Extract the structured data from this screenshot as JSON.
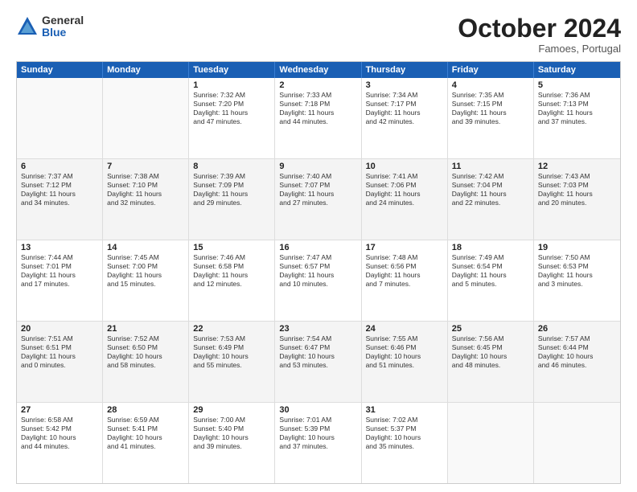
{
  "logo": {
    "general": "General",
    "blue": "Blue"
  },
  "title": "October 2024",
  "location": "Famoes, Portugal",
  "header_days": [
    "Sunday",
    "Monday",
    "Tuesday",
    "Wednesday",
    "Thursday",
    "Friday",
    "Saturday"
  ],
  "weeks": [
    {
      "alt": false,
      "days": [
        {
          "num": "",
          "lines": [],
          "empty": true
        },
        {
          "num": "",
          "lines": [],
          "empty": true
        },
        {
          "num": "1",
          "lines": [
            "Sunrise: 7:32 AM",
            "Sunset: 7:20 PM",
            "Daylight: 11 hours",
            "and 47 minutes."
          ],
          "empty": false
        },
        {
          "num": "2",
          "lines": [
            "Sunrise: 7:33 AM",
            "Sunset: 7:18 PM",
            "Daylight: 11 hours",
            "and 44 minutes."
          ],
          "empty": false
        },
        {
          "num": "3",
          "lines": [
            "Sunrise: 7:34 AM",
            "Sunset: 7:17 PM",
            "Daylight: 11 hours",
            "and 42 minutes."
          ],
          "empty": false
        },
        {
          "num": "4",
          "lines": [
            "Sunrise: 7:35 AM",
            "Sunset: 7:15 PM",
            "Daylight: 11 hours",
            "and 39 minutes."
          ],
          "empty": false
        },
        {
          "num": "5",
          "lines": [
            "Sunrise: 7:36 AM",
            "Sunset: 7:13 PM",
            "Daylight: 11 hours",
            "and 37 minutes."
          ],
          "empty": false
        }
      ]
    },
    {
      "alt": true,
      "days": [
        {
          "num": "6",
          "lines": [
            "Sunrise: 7:37 AM",
            "Sunset: 7:12 PM",
            "Daylight: 11 hours",
            "and 34 minutes."
          ],
          "empty": false
        },
        {
          "num": "7",
          "lines": [
            "Sunrise: 7:38 AM",
            "Sunset: 7:10 PM",
            "Daylight: 11 hours",
            "and 32 minutes."
          ],
          "empty": false
        },
        {
          "num": "8",
          "lines": [
            "Sunrise: 7:39 AM",
            "Sunset: 7:09 PM",
            "Daylight: 11 hours",
            "and 29 minutes."
          ],
          "empty": false
        },
        {
          "num": "9",
          "lines": [
            "Sunrise: 7:40 AM",
            "Sunset: 7:07 PM",
            "Daylight: 11 hours",
            "and 27 minutes."
          ],
          "empty": false
        },
        {
          "num": "10",
          "lines": [
            "Sunrise: 7:41 AM",
            "Sunset: 7:06 PM",
            "Daylight: 11 hours",
            "and 24 minutes."
          ],
          "empty": false
        },
        {
          "num": "11",
          "lines": [
            "Sunrise: 7:42 AM",
            "Sunset: 7:04 PM",
            "Daylight: 11 hours",
            "and 22 minutes."
          ],
          "empty": false
        },
        {
          "num": "12",
          "lines": [
            "Sunrise: 7:43 AM",
            "Sunset: 7:03 PM",
            "Daylight: 11 hours",
            "and 20 minutes."
          ],
          "empty": false
        }
      ]
    },
    {
      "alt": false,
      "days": [
        {
          "num": "13",
          "lines": [
            "Sunrise: 7:44 AM",
            "Sunset: 7:01 PM",
            "Daylight: 11 hours",
            "and 17 minutes."
          ],
          "empty": false
        },
        {
          "num": "14",
          "lines": [
            "Sunrise: 7:45 AM",
            "Sunset: 7:00 PM",
            "Daylight: 11 hours",
            "and 15 minutes."
          ],
          "empty": false
        },
        {
          "num": "15",
          "lines": [
            "Sunrise: 7:46 AM",
            "Sunset: 6:58 PM",
            "Daylight: 11 hours",
            "and 12 minutes."
          ],
          "empty": false
        },
        {
          "num": "16",
          "lines": [
            "Sunrise: 7:47 AM",
            "Sunset: 6:57 PM",
            "Daylight: 11 hours",
            "and 10 minutes."
          ],
          "empty": false
        },
        {
          "num": "17",
          "lines": [
            "Sunrise: 7:48 AM",
            "Sunset: 6:56 PM",
            "Daylight: 11 hours",
            "and 7 minutes."
          ],
          "empty": false
        },
        {
          "num": "18",
          "lines": [
            "Sunrise: 7:49 AM",
            "Sunset: 6:54 PM",
            "Daylight: 11 hours",
            "and 5 minutes."
          ],
          "empty": false
        },
        {
          "num": "19",
          "lines": [
            "Sunrise: 7:50 AM",
            "Sunset: 6:53 PM",
            "Daylight: 11 hours",
            "and 3 minutes."
          ],
          "empty": false
        }
      ]
    },
    {
      "alt": true,
      "days": [
        {
          "num": "20",
          "lines": [
            "Sunrise: 7:51 AM",
            "Sunset: 6:51 PM",
            "Daylight: 11 hours",
            "and 0 minutes."
          ],
          "empty": false
        },
        {
          "num": "21",
          "lines": [
            "Sunrise: 7:52 AM",
            "Sunset: 6:50 PM",
            "Daylight: 10 hours",
            "and 58 minutes."
          ],
          "empty": false
        },
        {
          "num": "22",
          "lines": [
            "Sunrise: 7:53 AM",
            "Sunset: 6:49 PM",
            "Daylight: 10 hours",
            "and 55 minutes."
          ],
          "empty": false
        },
        {
          "num": "23",
          "lines": [
            "Sunrise: 7:54 AM",
            "Sunset: 6:47 PM",
            "Daylight: 10 hours",
            "and 53 minutes."
          ],
          "empty": false
        },
        {
          "num": "24",
          "lines": [
            "Sunrise: 7:55 AM",
            "Sunset: 6:46 PM",
            "Daylight: 10 hours",
            "and 51 minutes."
          ],
          "empty": false
        },
        {
          "num": "25",
          "lines": [
            "Sunrise: 7:56 AM",
            "Sunset: 6:45 PM",
            "Daylight: 10 hours",
            "and 48 minutes."
          ],
          "empty": false
        },
        {
          "num": "26",
          "lines": [
            "Sunrise: 7:57 AM",
            "Sunset: 6:44 PM",
            "Daylight: 10 hours",
            "and 46 minutes."
          ],
          "empty": false
        }
      ]
    },
    {
      "alt": false,
      "days": [
        {
          "num": "27",
          "lines": [
            "Sunrise: 6:58 AM",
            "Sunset: 5:42 PM",
            "Daylight: 10 hours",
            "and 44 minutes."
          ],
          "empty": false
        },
        {
          "num": "28",
          "lines": [
            "Sunrise: 6:59 AM",
            "Sunset: 5:41 PM",
            "Daylight: 10 hours",
            "and 41 minutes."
          ],
          "empty": false
        },
        {
          "num": "29",
          "lines": [
            "Sunrise: 7:00 AM",
            "Sunset: 5:40 PM",
            "Daylight: 10 hours",
            "and 39 minutes."
          ],
          "empty": false
        },
        {
          "num": "30",
          "lines": [
            "Sunrise: 7:01 AM",
            "Sunset: 5:39 PM",
            "Daylight: 10 hours",
            "and 37 minutes."
          ],
          "empty": false
        },
        {
          "num": "31",
          "lines": [
            "Sunrise: 7:02 AM",
            "Sunset: 5:37 PM",
            "Daylight: 10 hours",
            "and 35 minutes."
          ],
          "empty": false
        },
        {
          "num": "",
          "lines": [],
          "empty": true
        },
        {
          "num": "",
          "lines": [],
          "empty": true
        }
      ]
    }
  ]
}
